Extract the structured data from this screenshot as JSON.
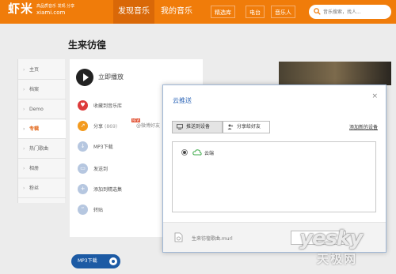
{
  "header": {
    "logo_name": "虾米",
    "logo_slogan": "高品质音乐 发现 分享",
    "logo_domain": "xiami.com",
    "nav_main": [
      "发现音乐",
      "我的音乐"
    ],
    "nav_sub": [
      "精选库",
      "电台",
      "音乐人"
    ],
    "search_placeholder": "音乐搜索，找人..."
  },
  "page": {
    "title": "生来彷徨"
  },
  "left_nav": {
    "items": [
      "主页",
      "档案",
      "Demo",
      "专辑",
      "热门歌曲",
      "相册",
      "粉丝"
    ],
    "active": "专辑"
  },
  "content": {
    "play_label": "立即播放",
    "actions": {
      "collect": "收藏到音乐库",
      "share": "分享",
      "share_count": "(869)",
      "share_badge": "NEW",
      "share_weibo": "@微博好友",
      "mp3": "MP3下载",
      "send": "发送到",
      "add_collection": "添加到精选集",
      "repost": "转贴"
    },
    "mp3_button": "MP3下载"
  },
  "dialog": {
    "title": "云推送",
    "close": "×",
    "tabs": [
      "推送到设备",
      "分享给好友"
    ],
    "add_device": "添加新的设备",
    "device": "云端",
    "file_name": "生来彷徨歌曲.murl"
  },
  "watermark": {
    "en": "yesky",
    "cn": "天极网"
  },
  "colors": {
    "brand": "#f07c0a",
    "accent_blue": "#2a63b6",
    "active_nav": "#e06010"
  }
}
